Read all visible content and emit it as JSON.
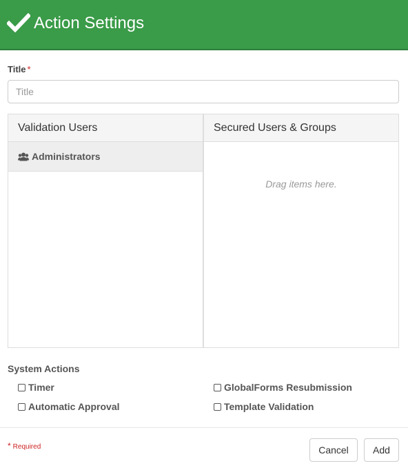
{
  "header": {
    "title": "Action Settings",
    "icon": "check-icon",
    "background": "#3a9b48"
  },
  "form": {
    "title_label": "Title",
    "required_marker": "*",
    "title_placeholder": "Title",
    "title_value": ""
  },
  "validation_panel": {
    "header": "Validation Users",
    "items": [
      {
        "label": "Administrators",
        "icon": "users-icon"
      }
    ]
  },
  "secured_panel": {
    "header": "Secured Users & Groups",
    "empty_hint": "Drag items here."
  },
  "system_actions": {
    "label": "System Actions",
    "options": [
      {
        "label": "Timer",
        "checked": false
      },
      {
        "label": "GlobalForms Resubmission",
        "checked": false
      },
      {
        "label": "Automatic Approval",
        "checked": false
      },
      {
        "label": "Template Validation",
        "checked": false
      }
    ]
  },
  "footer": {
    "required_star": "*",
    "required_text": "Required",
    "cancel_label": "Cancel",
    "add_label": "Add"
  }
}
